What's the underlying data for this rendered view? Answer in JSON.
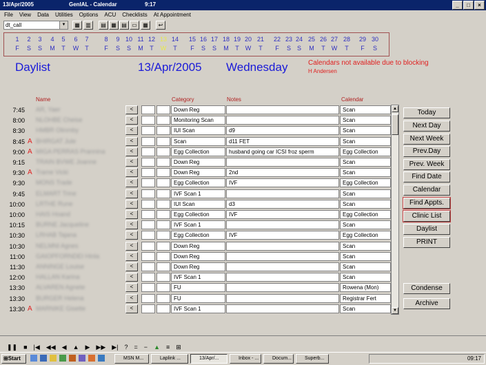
{
  "window": {
    "icon_text": "13/Apr/2005",
    "app": "GenIAL - Calendar",
    "time": "9:17"
  },
  "menu": [
    "File",
    "View",
    "Data",
    "Utilities",
    "Options",
    "ACU",
    "Checklists",
    "At Appointment"
  ],
  "toolbar": {
    "combo_value": "dt_call"
  },
  "date_strip": [
    {
      "d": "1",
      "w": "F"
    },
    {
      "d": "2",
      "w": "S"
    },
    {
      "d": "3",
      "w": "S"
    },
    {
      "d": "4",
      "w": "M"
    },
    {
      "d": "5",
      "w": "T"
    },
    {
      "d": "6",
      "w": "W"
    },
    {
      "d": "7",
      "w": "T"
    },
    {
      "d": "8",
      "w": "F"
    },
    {
      "d": "9",
      "w": "S"
    },
    {
      "d": "10",
      "w": "S"
    },
    {
      "d": "11",
      "w": "M"
    },
    {
      "d": "12",
      "w": "T"
    },
    {
      "d": "13",
      "w": "W"
    },
    {
      "d": "14",
      "w": "T"
    },
    {
      "d": "15",
      "w": "F"
    },
    {
      "d": "16",
      "w": "S"
    },
    {
      "d": "17",
      "w": "S"
    },
    {
      "d": "18",
      "w": "M"
    },
    {
      "d": "19",
      "w": "T"
    },
    {
      "d": "20",
      "w": "W"
    },
    {
      "d": "21",
      "w": "T"
    },
    {
      "d": "22",
      "w": "F"
    },
    {
      "d": "23",
      "w": "S"
    },
    {
      "d": "24",
      "w": "S"
    },
    {
      "d": "25",
      "w": "M"
    },
    {
      "d": "26",
      "w": "T"
    },
    {
      "d": "27",
      "w": "W"
    },
    {
      "d": "28",
      "w": "T"
    },
    {
      "d": "29",
      "w": "F"
    },
    {
      "d": "30",
      "w": "S"
    }
  ],
  "header": {
    "title": "Daylist",
    "date": "13/Apr/2005",
    "weekday": "Wednesday",
    "warning": "Calendars not available due to blocking",
    "blocking_user": "H Andersen"
  },
  "columns": {
    "name": "Name",
    "category": "Category",
    "notes": "Notes",
    "calendar": "Calendar"
  },
  "rows": [
    {
      "time": "7:45",
      "flag": "",
      "name": "AR, Yaer",
      "category": "Down Reg",
      "notes": "",
      "calendar": "Scan"
    },
    {
      "time": "8:00",
      "flag": "",
      "name": "NLOHBE Cheise",
      "category": "Monitoring Scan",
      "notes": "",
      "calendar": "Scan"
    },
    {
      "time": "8:30",
      "flag": "",
      "name": "HMBR Olinmby",
      "category": "IUI Scan",
      "notes": "d9",
      "calendar": "Scan"
    },
    {
      "time": "8:45",
      "flag": "A",
      "name": "BHIRGAT Jule",
      "category": "Scan",
      "notes": "d11 FET",
      "calendar": "Scan"
    },
    {
      "time": "9:00",
      "flag": "A",
      "name": "MIGA PERRAS Prannina",
      "category": "Egg Collection",
      "notes": "husband going car ICSI froz sperm",
      "calendar": "Egg Collection"
    },
    {
      "time": "9:15",
      "flag": "",
      "name": "TRAIN BVWE Joanne",
      "category": "Down Reg",
      "notes": "",
      "calendar": "Scan"
    },
    {
      "time": "9:30",
      "flag": "A",
      "name": "Trame Vicki",
      "category": "Down Reg",
      "notes": "2nd",
      "calendar": "Scan"
    },
    {
      "time": "9:30",
      "flag": "",
      "name": "MONS Trade",
      "category": "Egg Collection",
      "notes": "IVF",
      "calendar": "Egg Collection"
    },
    {
      "time": "9:45",
      "flag": "",
      "name": "ELMART Trine",
      "category": "IVF Scan 1",
      "notes": "",
      "calendar": "Scan"
    },
    {
      "time": "10:00",
      "flag": "",
      "name": "LRTHE Rune",
      "category": "IUI Scan",
      "notes": "d3",
      "calendar": "Scan"
    },
    {
      "time": "10:00",
      "flag": "",
      "name": "HAIS Hoand",
      "category": "Egg Collection",
      "notes": "IVF",
      "calendar": "Egg Collection"
    },
    {
      "time": "10:15",
      "flag": "",
      "name": "BURNE Jacqueline",
      "category": "IVF Scan 1",
      "notes": "",
      "calendar": "Scan"
    },
    {
      "time": "10:30",
      "flag": "",
      "name": "LRHAB Tajana",
      "category": "Egg Collection",
      "notes": "IVF",
      "calendar": "Egg Collection"
    },
    {
      "time": "10:30",
      "flag": "",
      "name": "NELMNI Agnes",
      "category": "Down Reg",
      "notes": "",
      "calendar": "Scan"
    },
    {
      "time": "11:00",
      "flag": "",
      "name": "GAIOPFORNDEI Hinla",
      "category": "Down Reg",
      "notes": "",
      "calendar": "Scan"
    },
    {
      "time": "11:30",
      "flag": "",
      "name": "ANNINGE Louise",
      "category": "Down Reg",
      "notes": "",
      "calendar": "Scan"
    },
    {
      "time": "12:00",
      "flag": "",
      "name": "HALLAN Karina",
      "category": "IVF Scan 1",
      "notes": "",
      "calendar": "Scan"
    },
    {
      "time": "13:30",
      "flag": "",
      "name": "ALVAREN Agnete",
      "category": "FU",
      "notes": "",
      "calendar": "Rowena (Mon)"
    },
    {
      "time": "13:30",
      "flag": "",
      "name": "BURGER Helena",
      "category": "FU",
      "notes": "",
      "calendar": "Registrar Fert"
    },
    {
      "time": "13:30",
      "flag": "A",
      "name": "MARNIKE Gisette",
      "category": "IVF Scan 1",
      "notes": "",
      "calendar": "Scan"
    }
  ],
  "right_buttons": [
    "Today",
    "Next Day",
    "Next Week",
    "Prev.Day",
    "Prev. Week",
    "Find Date",
    "Calendar",
    "Find Appts.",
    "Clinic List",
    "Daylist",
    "PRINT"
  ],
  "bottom_buttons": [
    "Condense",
    "Archive"
  ],
  "taskbar": {
    "start": "Start",
    "tasks": [
      "MSN M...",
      "Laplink ...",
      "13/Apr/...",
      "Inbox - ...",
      "Docum...",
      "Superb..."
    ],
    "clock": "09:17"
  }
}
